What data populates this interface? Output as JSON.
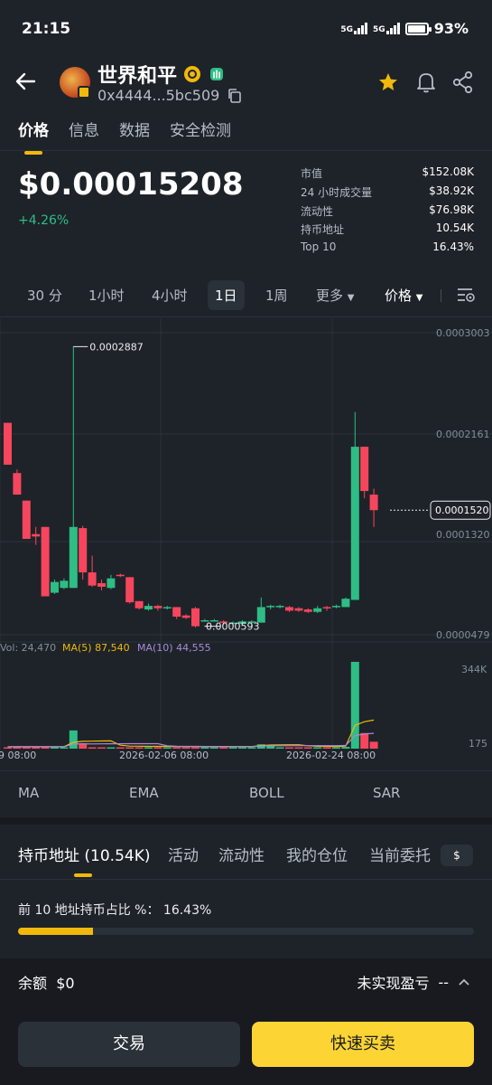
{
  "status_bar": {
    "time": "21:15",
    "network1": "5G",
    "network2": "5G",
    "battery": "93%"
  },
  "header": {
    "title": "世界和平",
    "address": "0x4444...5bc509",
    "icons": [
      "back-arrow-icon",
      "star-icon",
      "bell-icon",
      "share-icon",
      "copy-icon"
    ]
  },
  "tabs": [
    {
      "label": "价格"
    },
    {
      "label": "信息"
    },
    {
      "label": "数据"
    },
    {
      "label": "安全检测"
    }
  ],
  "price": {
    "value": "$0.00015208",
    "change": "+4.26%"
  },
  "stats": [
    {
      "key": "市值",
      "value": "$152.08K"
    },
    {
      "key": "24 小时成交量",
      "value": "$38.92K"
    },
    {
      "key": "流动性",
      "value": "$76.98K"
    },
    {
      "key": "持币地址",
      "value": "10.54K"
    },
    {
      "key": "Top 10",
      "value": "16.43%"
    }
  ],
  "intervals": [
    "30 分",
    "1小时",
    "4小时",
    "1日",
    "1周",
    "更多",
    "价格"
  ],
  "selected_interval": "1日",
  "chart_data": {
    "type": "candlestick",
    "y_ticks": [
      "0.0003003",
      "0.0002161",
      "0.0001320",
      "0.0000479"
    ],
    "ylim": [
      4.79e-05,
      0.0003003
    ],
    "max_label": "0.0002887",
    "min_label": "0.0000593",
    "current_label": "0.0001520",
    "x_ticks": [
      "9 08:00",
      "2026-02-06 08:00",
      "2026-02-24 08:00"
    ],
    "volume": {
      "label": "Vol: 24,470",
      "ma5": "MA(5) 87,540",
      "ma10": "MA(10) 44,555",
      "axis_top": "344K",
      "axis_bottom": "175"
    },
    "candles": [
      {
        "o": 0.000225,
        "h": 0.000225,
        "l": 0.00019,
        "c": 0.00019
      },
      {
        "o": 0.000183,
        "h": 0.000186,
        "l": 0.000165,
        "c": 0.000165
      },
      {
        "o": 0.00016,
        "h": 0.00016,
        "l": 0.000128,
        "c": 0.000128
      },
      {
        "o": 0.000132,
        "h": 0.000138,
        "l": 0.000123,
        "c": 0.00013
      },
      {
        "o": 0.000138,
        "h": 0.000138,
        "l": 8e-05,
        "c": 8e-05
      },
      {
        "o": 8.3e-05,
        "h": 9.4e-05,
        "l": 8.2e-05,
        "c": 9.2e-05
      },
      {
        "o": 8.7e-05,
        "h": 9.5e-05,
        "l": 8.6e-05,
        "c": 9.3e-05
      },
      {
        "o": 8.7e-05,
        "h": 0.000289,
        "l": 8.7e-05,
        "c": 0.000138
      },
      {
        "o": 0.000137,
        "h": 0.000139,
        "l": 9.4e-05,
        "c": 0.0001
      },
      {
        "o": 0.0001,
        "h": 0.000114,
        "l": 8.8e-05,
        "c": 8.9e-05
      },
      {
        "o": 9.1e-05,
        "h": 9.4e-05,
        "l": 8.5e-05,
        "c": 8.8e-05
      },
      {
        "o": 8.7e-05,
        "h": 9.8e-05,
        "l": 8.6e-05,
        "c": 9.5e-05
      },
      {
        "o": 9.8e-05,
        "h": 9.9e-05,
        "l": 9.6e-05,
        "c": 9.7e-05
      },
      {
        "o": 9.6e-05,
        "h": 9.6e-05,
        "l": 7.4e-05,
        "c": 7.5e-05
      },
      {
        "o": 7.6e-05,
        "h": 7.6e-05,
        "l": 6.9e-05,
        "c": 7e-05
      },
      {
        "o": 6.9e-05,
        "h": 7.4e-05,
        "l": 6.8e-05,
        "c": 7.2e-05
      },
      {
        "o": 7.2e-05,
        "h": 7.3e-05,
        "l": 6.8e-05,
        "c": 7e-05
      },
      {
        "o": 7e-05,
        "h": 7.2e-05,
        "l": 6.9e-05,
        "c": 7.1e-05
      },
      {
        "o": 7.1e-05,
        "h": 7.1e-05,
        "l": 6.1e-05,
        "c": 6.3e-05
      },
      {
        "o": 6.4e-05,
        "h": 6.5e-05,
        "l": 6.1e-05,
        "c": 6.2e-05
      },
      {
        "o": 7e-05,
        "h": 7.1e-05,
        "l": 5.4e-05,
        "c": 5.5e-05
      },
      {
        "o": 6e-05,
        "h": 6.1e-05,
        "l": 5.9e-05,
        "c": 6e-05
      },
      {
        "o": 5.9e-05,
        "h": 6.1e-05,
        "l": 5.9e-05,
        "c": 6e-05
      },
      {
        "o": 5.9e-05,
        "h": 6e-05,
        "l": 5.6e-05,
        "c": 5.8e-05
      },
      {
        "o": 5.8e-05,
        "h": 5.9e-05,
        "l": 5.7e-05,
        "c": 5.8e-05
      },
      {
        "o": 5.7e-05,
        "h": 6e-05,
        "l": 5.6e-05,
        "c": 5.9e-05
      },
      {
        "o": 5.8e-05,
        "h": 6e-05,
        "l": 5.7e-05,
        "c": 5.9e-05
      },
      {
        "o": 5.8e-05,
        "h": 7.9e-05,
        "l": 5.8e-05,
        "c": 7.1e-05
      },
      {
        "o": 7.1e-05,
        "h": 7.3e-05,
        "l": 6.9e-05,
        "c": 7.2e-05
      },
      {
        "o": 7.2e-05,
        "h": 7.3e-05,
        "l": 7e-05,
        "c": 7.2e-05
      },
      {
        "o": 7.1e-05,
        "h": 7.2e-05,
        "l": 6.7e-05,
        "c": 6.8e-05
      },
      {
        "o": 7e-05,
        "h": 7.1e-05,
        "l": 6.7e-05,
        "c": 6.8e-05
      },
      {
        "o": 6.9e-05,
        "h": 7e-05,
        "l": 6.6e-05,
        "c": 6.7e-05
      },
      {
        "o": 6.7e-05,
        "h": 7.2e-05,
        "l": 6.6e-05,
        "c": 7e-05
      },
      {
        "o": 7.1e-05,
        "h": 7.2e-05,
        "l": 6.8e-05,
        "c": 7e-05
      },
      {
        "o": 7.1e-05,
        "h": 7.3e-05,
        "l": 7e-05,
        "c": 7.2e-05
      },
      {
        "o": 7.1e-05,
        "h": 7.9e-05,
        "l": 7.1e-05,
        "c": 7.8e-05
      },
      {
        "o": 7.7e-05,
        "h": 0.000234,
        "l": 7.7e-05,
        "c": 0.000205
      },
      {
        "o": 0.000205,
        "h": 0.000205,
        "l": 0.000162,
        "c": 0.000168
      },
      {
        "o": 0.000165,
        "h": 0.00017,
        "l": 0.000138,
        "c": 0.000152
      }
    ],
    "volumes": [
      0,
      0.002,
      0.001,
      0.001,
      0.002,
      0.001,
      0.002,
      0.21,
      0.05,
      0.01,
      0.01,
      0.005,
      0.005,
      0.005,
      0.004,
      0.004,
      0.003,
      0.004,
      0.004,
      0.003,
      0.003,
      0.002,
      0.002,
      0.002,
      0.002,
      0.003,
      0.003,
      0.05,
      0.03,
      0.01,
      0.005,
      0.004,
      0.004,
      0.003,
      0.004,
      0.004,
      0.02,
      1.0,
      0.18,
      0.08
    ],
    "colors": {
      "up": "#2ebd85",
      "down": "#f6465d",
      "ma5": "#f0b90b",
      "ma10": "#a98bd8",
      "grid": "#2b3139"
    }
  },
  "indicators": [
    "MA",
    "EMA",
    "BOLL",
    "SAR"
  ],
  "holders_tabs": [
    "持币地址 (10.54K)",
    "活动",
    "流动性",
    "我的仓位",
    "当前委托"
  ],
  "currency_button": "$",
  "top10": {
    "label": "前 10 地址持币占比 %： 16.43%",
    "percent": 16.43
  },
  "balance": {
    "label": "余额",
    "value": "$0",
    "pnl_label": "未实现盈亏",
    "pnl_value": "--"
  },
  "buttons": {
    "trade": "交易",
    "quick": "快速买卖"
  }
}
